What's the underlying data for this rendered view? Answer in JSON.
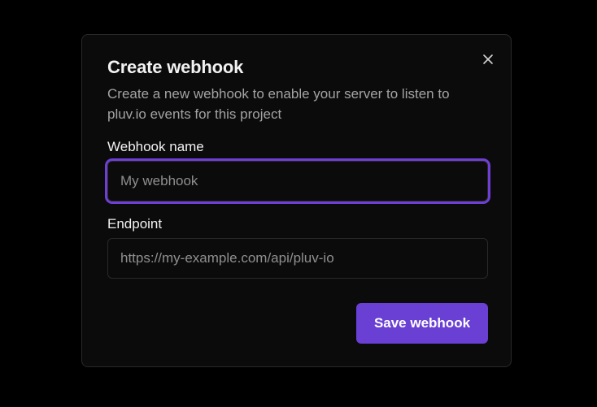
{
  "dialog": {
    "title": "Create webhook",
    "description": "Create a new webhook to enable your server to listen to pluv.io events for this project",
    "close_icon": "close-icon"
  },
  "form": {
    "webhook_name": {
      "label": "Webhook name",
      "placeholder": "My webhook",
      "value": ""
    },
    "endpoint": {
      "label": "Endpoint",
      "placeholder": "https://my-example.com/api/pluv-io",
      "value": ""
    },
    "save_label": "Save webhook"
  },
  "colors": {
    "background": "#000000",
    "dialog_bg": "#0c0b0b",
    "accent": "#6a3fd4",
    "focus_ring": "#6d3fd6",
    "text_primary": "#f2f2f2",
    "text_secondary": "#a3a3a3"
  }
}
